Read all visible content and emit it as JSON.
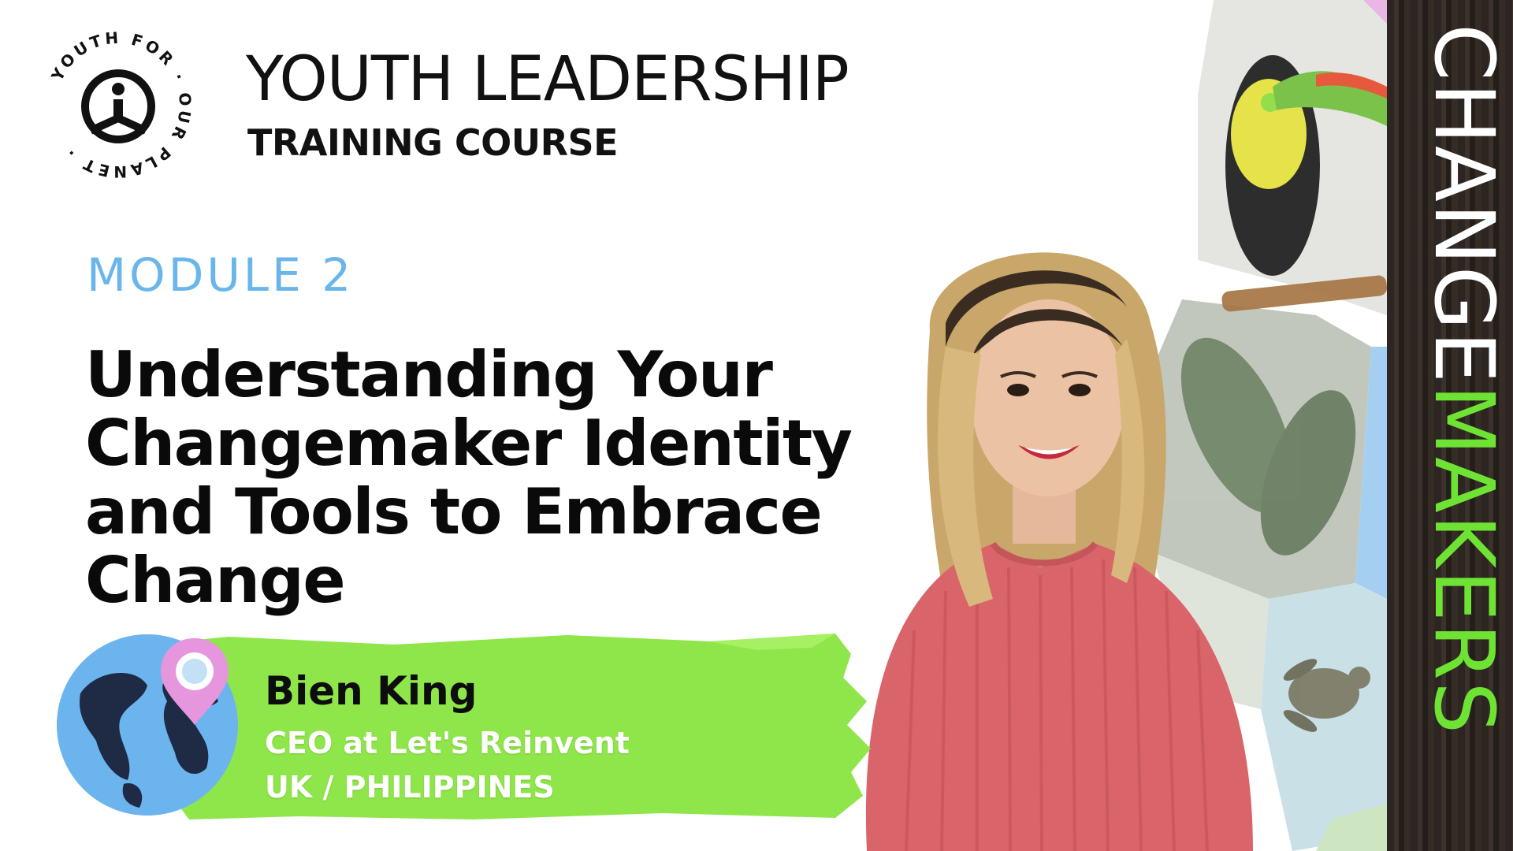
{
  "logo": {
    "ring_text": "YOUTH FOR · OUR PLANET ·",
    "icon": "person-circle-icon"
  },
  "course": {
    "title": "YOUTH LEADERSHIP",
    "subtitle": "TRAINING COURSE"
  },
  "module": {
    "label": "MODULE 2",
    "title_lines": [
      "Understanding Your",
      "Changemaker Identity",
      "and Tools to Embrace",
      "Change"
    ]
  },
  "presenter": {
    "name": "Bien King",
    "role": "CEO at Let's Reinvent",
    "location": "UK / PHILIPPINES",
    "globe_icon": "globe-icon",
    "pin_icon": "location-pin-icon"
  },
  "banner": {
    "part1": "CHANGE",
    "part2": "MAKERS"
  },
  "colors": {
    "module_blue": "#6ab6ea",
    "brush_green": "#8fe64a",
    "banner_green": "#6fe334",
    "banner_bark": "#2c2521",
    "shirt_pink": "#d9656a",
    "globe_blue": "#6cb4ee",
    "pin_pink": "#e596dc"
  }
}
